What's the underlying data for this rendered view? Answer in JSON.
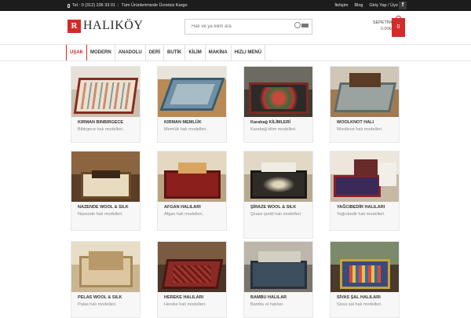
{
  "topbar": {
    "phone": "Tel : 0 (312) 236 33 01",
    "shipping": "Tüm Ürünlerimizde Ücretsiz Kargo",
    "links": [
      "İletişim",
      "Blog",
      "Giriş Yap / Üye Ol"
    ],
    "social": "f"
  },
  "header": {
    "logo_mark": "R",
    "logo_text": "HALIKÖY",
    "search_placeholder": "Halı ve ya kilim ara",
    "cart_label": "SEPETİM",
    "cart_amount": "0.00₺",
    "cart_count": "0"
  },
  "nav": {
    "items": [
      "UŞAK",
      "MODERN",
      "ANADOLU",
      "DERİ",
      "BUTİK",
      "KİLİM",
      "MAKİNA",
      "HIZLI MENÜ"
    ]
  },
  "products": [
    {
      "title": "KIRMAN BINBIRGECE",
      "sub": "Bibirgece halı modelleri."
    },
    {
      "title": "KIRMAN MEMLÜK",
      "sub": "Memlük halı modelleri."
    },
    {
      "title": "Karabağ KİLİMLERİ",
      "sub": "Karabağ kilim modelleri."
    },
    {
      "title": "WOOLKNOT HALI",
      "sub": "Woolknot halı modelleri."
    },
    {
      "title": "NAZENDE WOOL & SILK",
      "sub": "Nazende halı modelleri."
    },
    {
      "title": "AFGAN HALILARI",
      "sub": "Afgan halı modelleri."
    },
    {
      "title": "ŞİRAZE WOOL & SILK",
      "sub": "Şiraze ipekli halı modelleri."
    },
    {
      "title": "YAĞCIBEDİR HALILARI",
      "sub": "Yağcıbedir halı modelleri."
    },
    {
      "title": "PELAS WOOL & SILK",
      "sub": "Palas halı modelleri."
    },
    {
      "title": "HEREKE HALILARI",
      "sub": "Hereke halı modelleri."
    },
    {
      "title": "BAMBU HALILAR",
      "sub": "Bambu el halıları."
    },
    {
      "title": "SİVAS ŞAL HALILARI",
      "sub": "Sivas şal halı modelleri."
    }
  ],
  "colors": {
    "accent": "#d32a2a",
    "topbar_bg": "#1c1c1c"
  }
}
